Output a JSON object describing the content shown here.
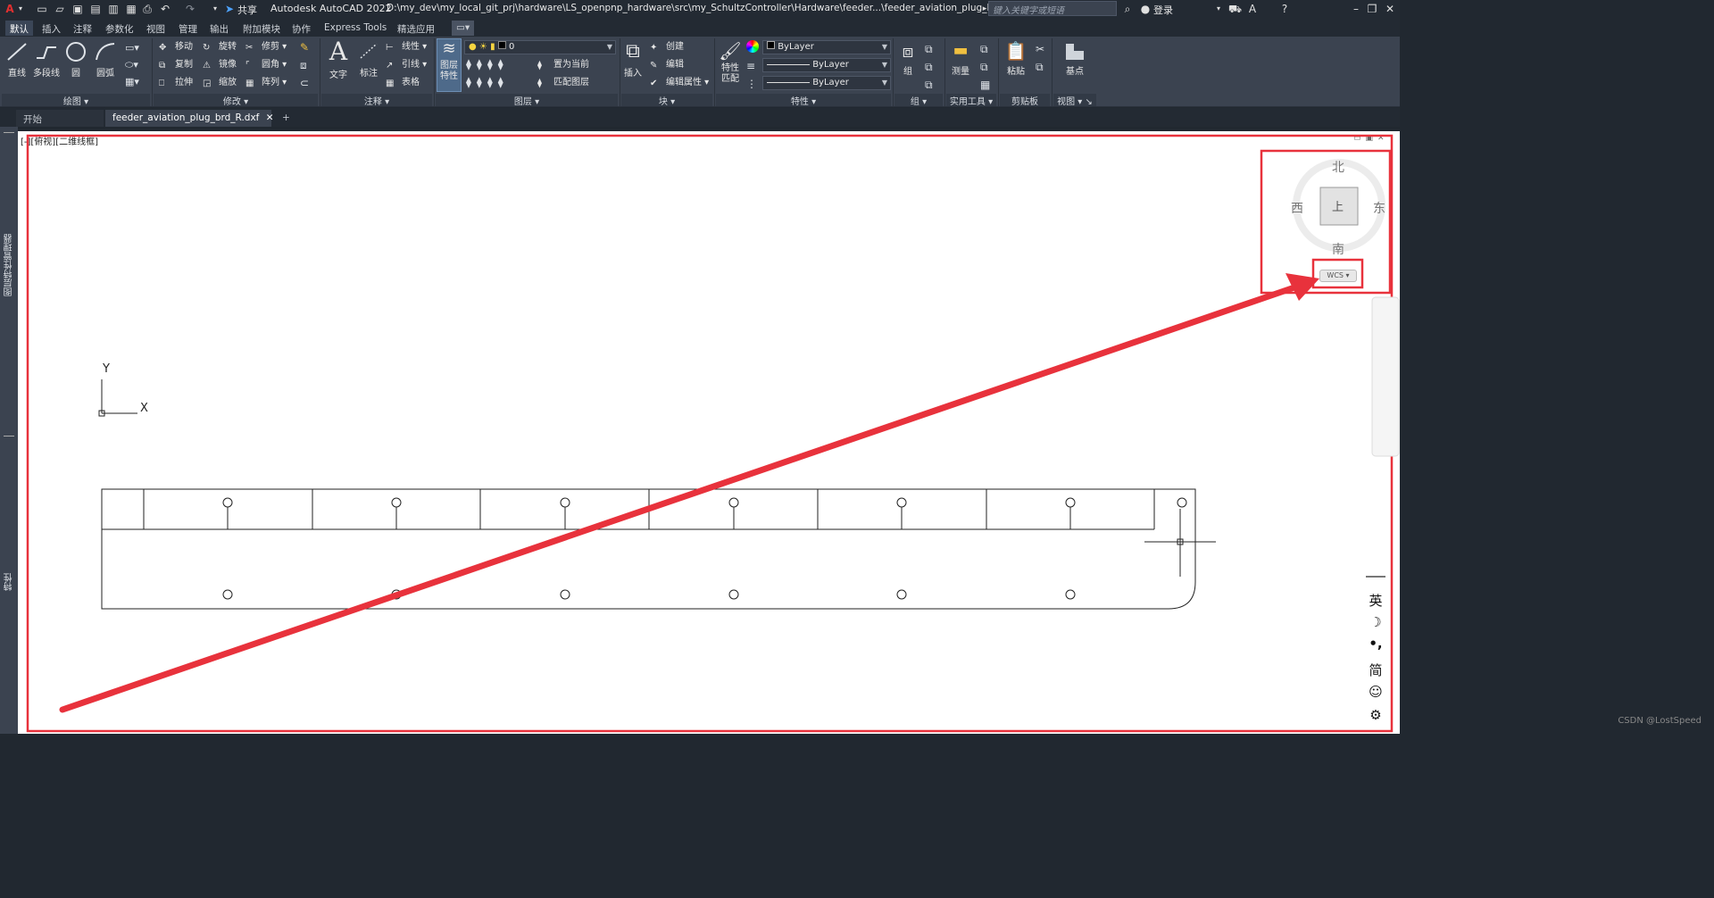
{
  "titlebar": {
    "app_title": "Autodesk AutoCAD 2022",
    "file_path": "D:\\my_dev\\my_local_git_prj\\hardware\\LS_openpnp_hardware\\src\\my_SchultzController\\Hardware\\feeder...\\feeder_aviation_plug_brd_R.dxf",
    "share_label": "共享",
    "search_placeholder": "键入关键字或短语",
    "login_label": "登录"
  },
  "ribbon_tabs": [
    "默认",
    "插入",
    "注释",
    "参数化",
    "视图",
    "管理",
    "输出",
    "附加模块",
    "协作",
    "Express Tools",
    "精选应用"
  ],
  "ribbon": {
    "draw": {
      "title": "绘图",
      "line": "直线",
      "polyline": "多段线",
      "circle": "圆",
      "arc": "圆弧"
    },
    "modify": {
      "title": "修改",
      "move": "移动",
      "rotate": "旋转",
      "trim": "修剪",
      "copy": "复制",
      "mirror": "镜像",
      "fillet": "圆角",
      "stretch": "拉伸",
      "scale": "缩放",
      "array": "阵列"
    },
    "annotation": {
      "title": "注释",
      "text": "文字",
      "dimension": "标注",
      "linear": "线性",
      "leader": "引线",
      "table": "表格"
    },
    "layers": {
      "title": "图层",
      "layer_props": "图层\n特性",
      "current_layer": "0",
      "set_current": "置为当前",
      "match_layer": "匹配图层"
    },
    "block": {
      "title": "块",
      "insert": "插入",
      "create": "创建",
      "edit": "编辑",
      "edit_attr": "编辑属性"
    },
    "properties": {
      "title": "特性",
      "match_props": "特性\n匹配",
      "color": "ByLayer",
      "linetype": "ByLayer",
      "lineweight": "ByLayer"
    },
    "groups": {
      "title": "组",
      "group": "组"
    },
    "utilities": {
      "title": "实用工具",
      "measure": "测量"
    },
    "clipboard": {
      "title": "剪贴板",
      "paste": "粘贴"
    },
    "view": {
      "title": "视图",
      "base": "基点"
    }
  },
  "doc_tabs": {
    "start": "开始",
    "file": "feeder_aviation_plug_brd_R.dxf",
    "add": "+"
  },
  "viewport": {
    "label": "[-][俯视][二维线框]"
  },
  "side_palettes": {
    "top": "图层特性管理器",
    "bottom": "特性"
  },
  "viewcube": {
    "north": "北",
    "south": "南",
    "east": "东",
    "west": "西",
    "face": "上",
    "wcs": "WCS"
  },
  "ucs": {
    "x": "X",
    "y": "Y"
  },
  "ime": {
    "lang": "英",
    "mode": "简"
  },
  "watermark": "CSDN @LostSpeed",
  "colors": {
    "highlight": "#e8323c",
    "arrow": "#e8323c",
    "bg_dark": "#212830",
    "ribbon": "#3b4350",
    "canvas": "#ffffff"
  }
}
